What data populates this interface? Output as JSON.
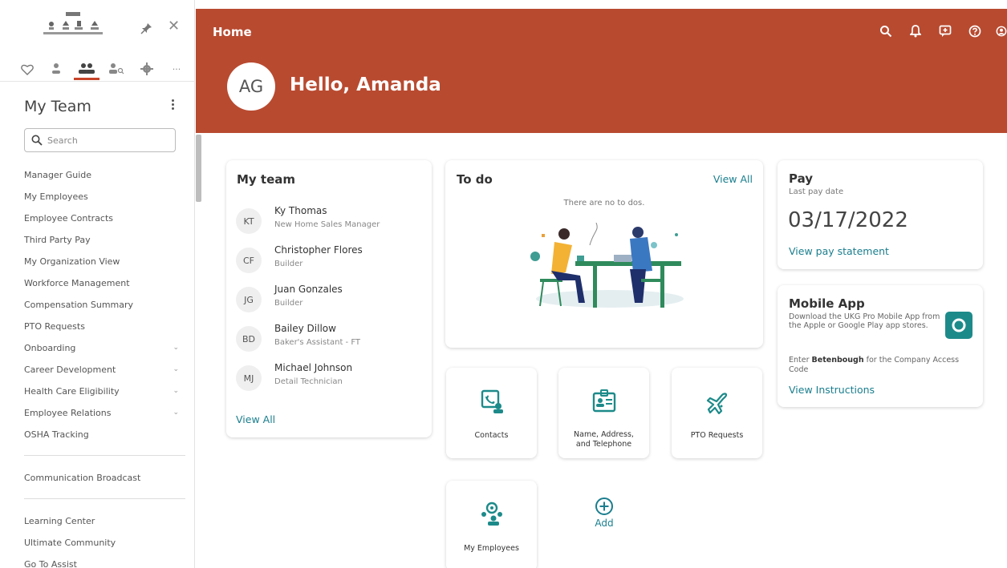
{
  "colors": {
    "brand": "#b84a30",
    "accent": "#1a7e8e",
    "teal_icon": "#1d8a8a"
  },
  "sidebar": {
    "header": "My Team",
    "search_placeholder": "Search",
    "tabs": [
      "heart-icon",
      "person-icon",
      "team-icon",
      "person-search-icon",
      "gear-icon",
      "more-icon"
    ],
    "items": [
      {
        "label": "Manager Guide",
        "expandable": false
      },
      {
        "label": "My Employees",
        "expandable": false
      },
      {
        "label": "Employee Contracts",
        "expandable": false
      },
      {
        "label": "Third Party Pay",
        "expandable": false
      },
      {
        "label": "My Organization View",
        "expandable": false
      },
      {
        "label": "Workforce Management",
        "expandable": false
      },
      {
        "label": "Compensation Summary",
        "expandable": false
      },
      {
        "label": "PTO Requests",
        "expandable": false
      },
      {
        "label": "Onboarding",
        "expandable": true
      },
      {
        "label": "Career Development",
        "expandable": true
      },
      {
        "label": "Health Care Eligibility",
        "expandable": true
      },
      {
        "label": "Employee Relations",
        "expandable": true
      },
      {
        "label": "OSHA Tracking",
        "expandable": false
      }
    ],
    "item_more_1": "Communication Broadcast",
    "items_bottom": [
      "Learning Center",
      "Ultimate Community",
      "Go To Assist"
    ]
  },
  "header": {
    "title": "Home",
    "avatar_initials": "AG",
    "greeting": "Hello, Amanda",
    "icons": [
      "search-icon",
      "bell-icon",
      "feedback-icon",
      "help-icon",
      "account-icon"
    ]
  },
  "my_team": {
    "title": "My team",
    "members": [
      {
        "initials": "KT",
        "name": "Ky Thomas",
        "role": "New Home Sales Manager"
      },
      {
        "initials": "CF",
        "name": "Christopher Flores",
        "role": "Builder"
      },
      {
        "initials": "JG",
        "name": "Juan Gonzales",
        "role": "Builder"
      },
      {
        "initials": "BD",
        "name": "Bailey Dillow",
        "role": "Baker's Assistant - FT"
      },
      {
        "initials": "MJ",
        "name": "Michael Johnson",
        "role": "Detail Technician"
      }
    ],
    "view_all": "View All"
  },
  "todo": {
    "title": "To do",
    "view_all": "View All",
    "empty": "There are no to dos."
  },
  "pay": {
    "title": "Pay",
    "subtitle": "Last pay date",
    "date": "03/17/2022",
    "link": "View pay statement"
  },
  "mobile": {
    "title": "Mobile App",
    "desc": "Download the UKG Pro Mobile App from the Apple or Google Play app stores.",
    "access_prefix": "Enter ",
    "access_code": "Betenbough",
    "access_suffix": " for the Company Access Code",
    "link": "View Instructions"
  },
  "tiles": {
    "contacts": "Contacts",
    "name_address_1": "Name, Address,",
    "name_address_2": "and Telephone",
    "pto": "PTO Requests",
    "my_employees": "My Employees",
    "add": "Add"
  }
}
